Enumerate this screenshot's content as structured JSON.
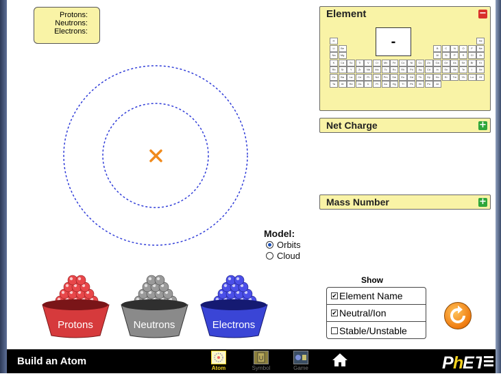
{
  "counts": {
    "protons_label": "Protons:",
    "neutrons_label": "Neutrons:",
    "electrons_label": "Electrons:"
  },
  "element_panel": {
    "title": "Element",
    "symbol": "-",
    "periodic_rows": [
      [
        "H",
        "",
        "",
        "",
        "",
        "",
        "",
        "",
        "",
        "",
        "",
        "",
        "",
        "",
        "",
        "",
        "",
        "He"
      ],
      [
        "Li",
        "Be",
        "",
        "",
        "",
        "",
        "",
        "",
        "",
        "",
        "",
        "",
        "B",
        "C",
        "N",
        "O",
        "F",
        "Ne"
      ],
      [
        "Na",
        "Mg",
        "",
        "",
        "",
        "",
        "",
        "",
        "",
        "",
        "",
        "",
        "Al",
        "Si",
        "P",
        "S",
        "Cl",
        "Ar"
      ],
      [
        "K",
        "Ca",
        "Sc",
        "Ti",
        "V",
        "Cr",
        "Mn",
        "Fe",
        "Co",
        "Ni",
        "Cu",
        "Zn",
        "Ga",
        "Ge",
        "As",
        "Se",
        "Br",
        "Kr"
      ],
      [
        "Rb",
        "Sr",
        "Y",
        "Zr",
        "Nb",
        "Mo",
        "Tc",
        "Ru",
        "Rh",
        "Pd",
        "Ag",
        "Cd",
        "In",
        "Sn",
        "Sb",
        "Te",
        "I",
        "Xe"
      ],
      [
        "Cs",
        "Ba",
        "La",
        "Ce",
        "Pr",
        "Nd",
        "Pm",
        "Sm",
        "Eu",
        "Gd",
        "Tb",
        "Dy",
        "Ho",
        "Er",
        "Tm",
        "Yb",
        "Lu",
        "Hf"
      ],
      [
        "Ta",
        "W",
        "Re",
        "Os",
        "Ir",
        "Pt",
        "Au",
        "Hg",
        "Tl",
        "Pb",
        "Bi",
        "Po",
        "At",
        "",
        "",
        "",
        "",
        ""
      ]
    ]
  },
  "net_charge_panel": {
    "title": "Net Charge"
  },
  "mass_number_panel": {
    "title": "Mass Number"
  },
  "model": {
    "title": "Model:",
    "options": [
      "Orbits",
      "Cloud"
    ],
    "selected": "Orbits"
  },
  "show": {
    "title": "Show",
    "options": [
      {
        "label": "Element Name",
        "checked": true
      },
      {
        "label": "Neutral/Ion",
        "checked": true
      },
      {
        "label": "Stable/Unstable",
        "checked": false
      }
    ]
  },
  "buckets": {
    "protons": "Protons",
    "neutrons": "Neutrons",
    "electrons": "Electrons"
  },
  "colors": {
    "proton": "#e8474a",
    "neutron": "#9a9a9a",
    "electron": "#4b4fe8",
    "panel": "#f9f3a6",
    "nucleus_marker": "#f08a1c"
  },
  "navbar": {
    "title": "Build an Atom",
    "screens": [
      {
        "label": "Atom",
        "icon": "atom-screen-icon",
        "active": true
      },
      {
        "label": "Symbol",
        "icon": "symbol-screen-icon",
        "active": false
      },
      {
        "label": "Game",
        "icon": "game-screen-icon",
        "active": false
      }
    ],
    "brand": "PhET"
  }
}
